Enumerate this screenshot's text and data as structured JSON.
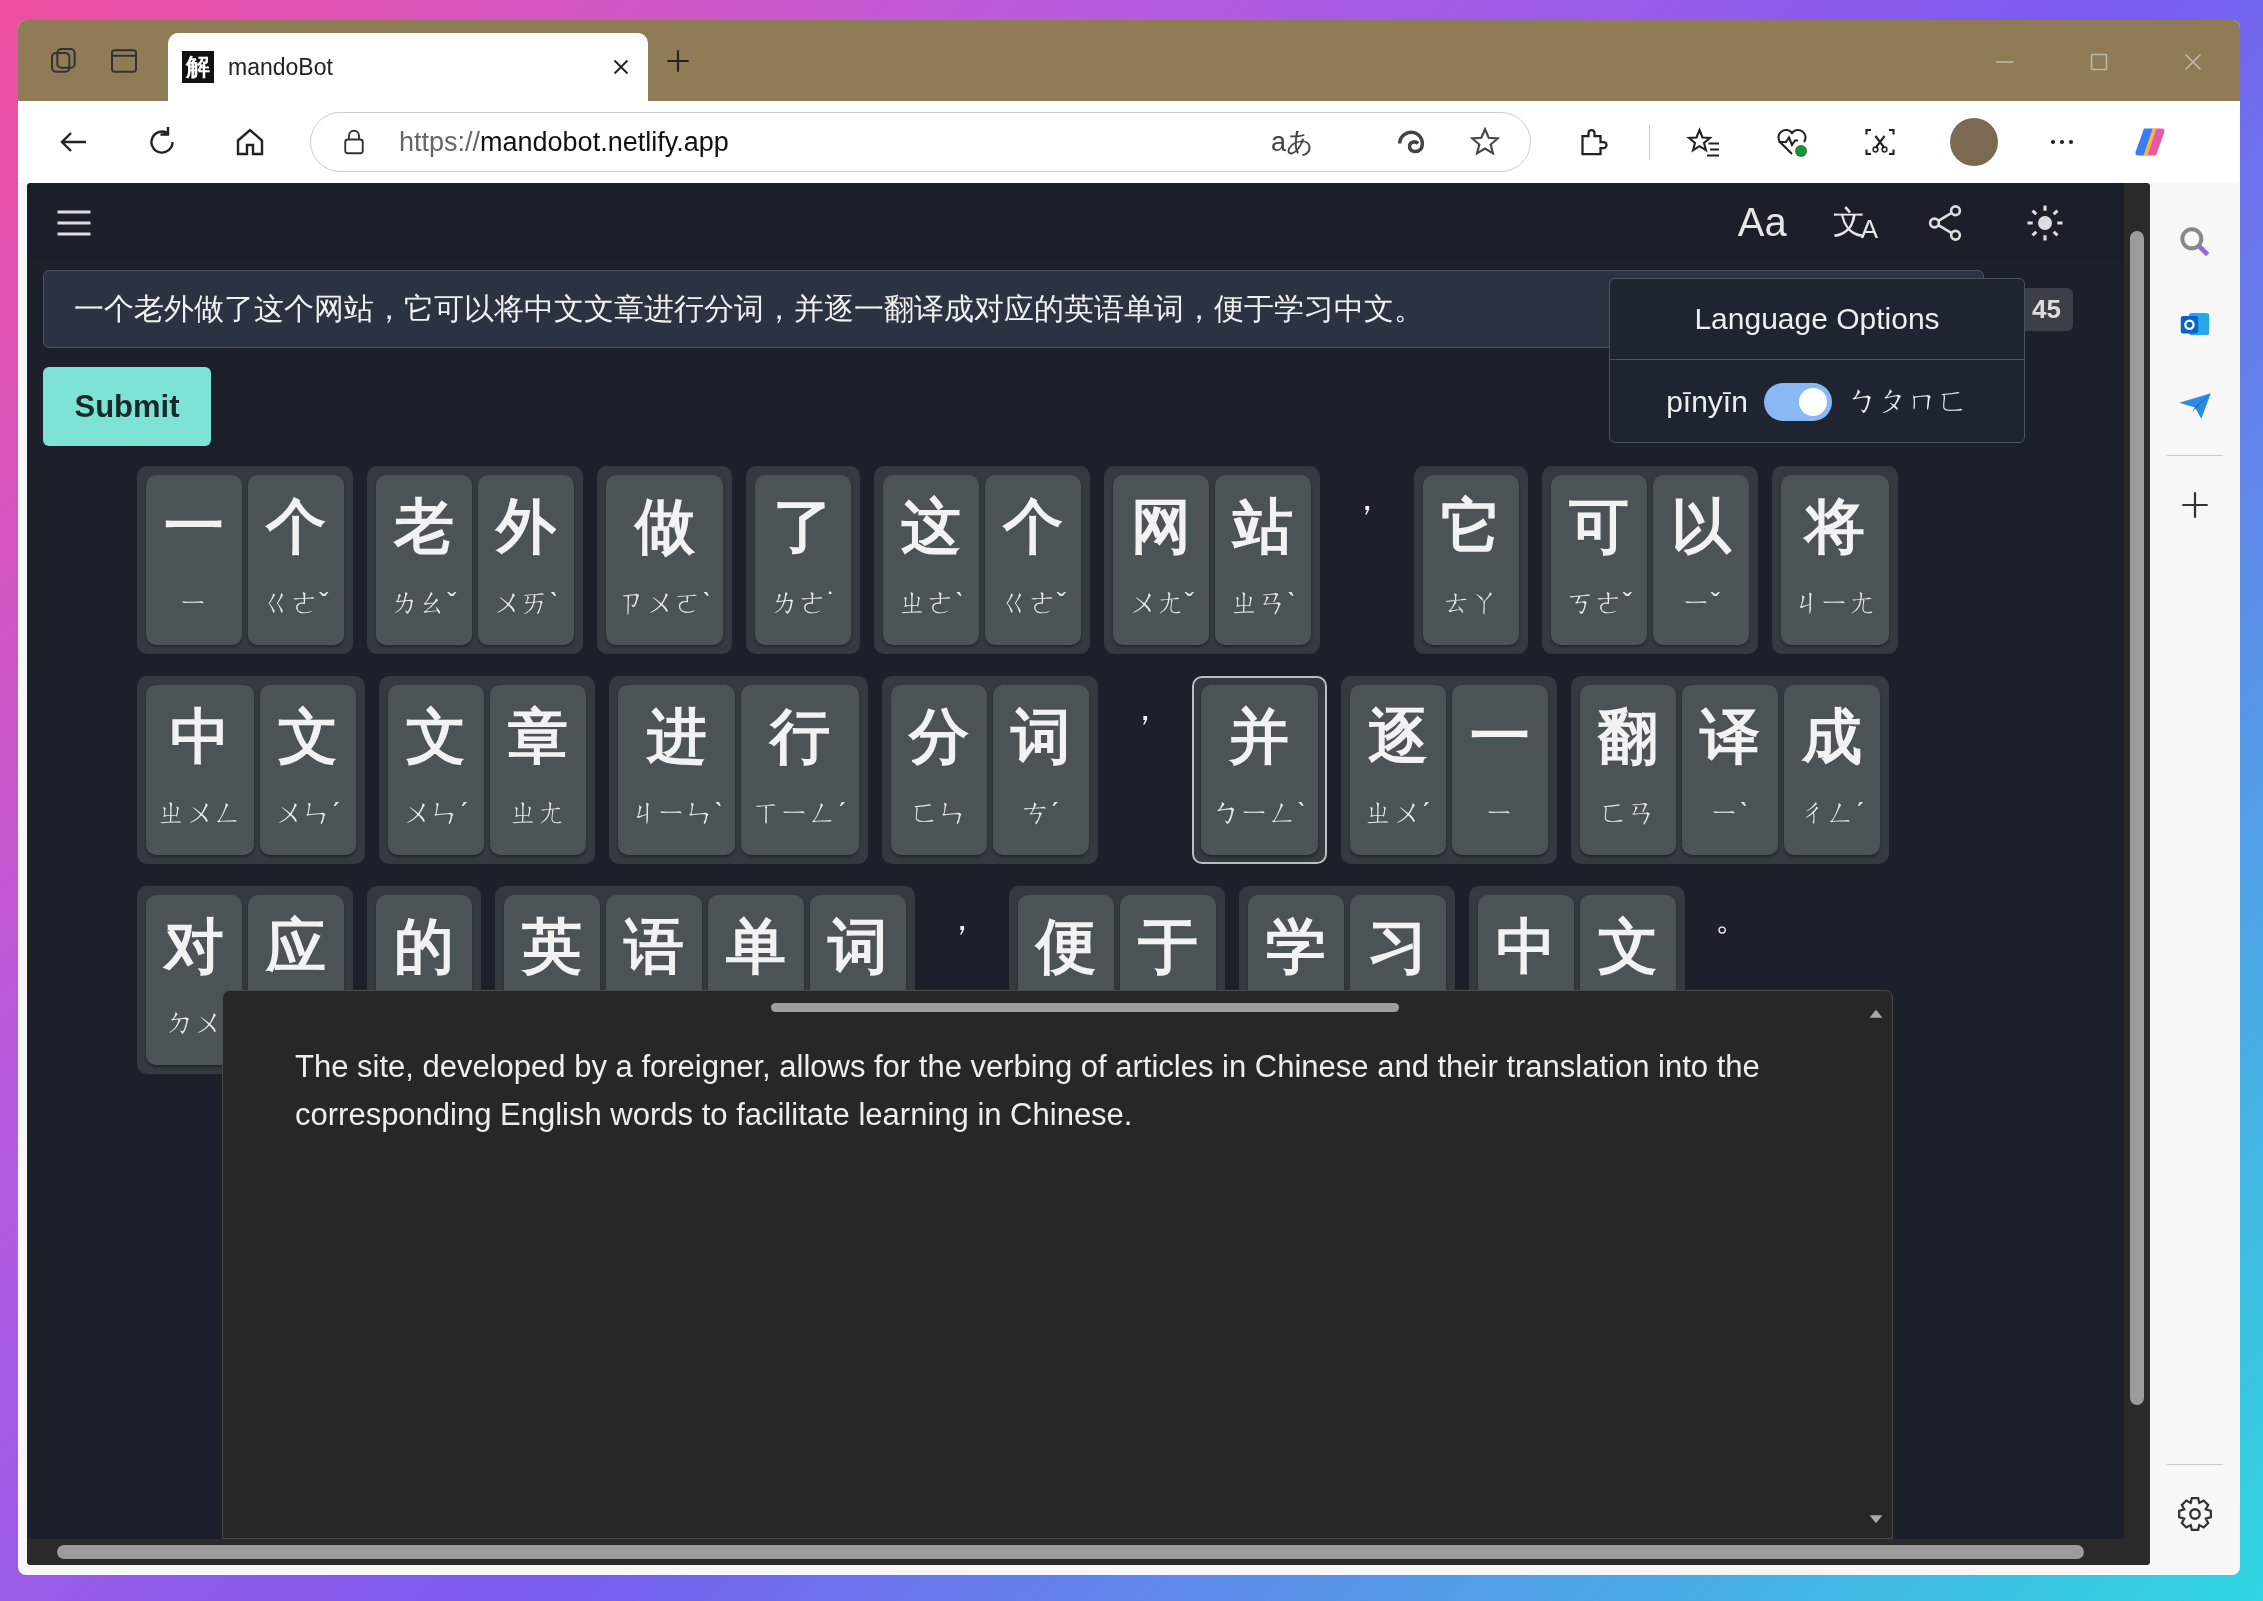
{
  "browser": {
    "tab": {
      "favicon": "解",
      "title": "mandoBot"
    },
    "address_bar": {
      "scheme": "https://",
      "host": "mandobot.netlify.app",
      "read_aloud_glyph": "aあ"
    }
  },
  "header": {
    "font_button": "Aa",
    "language_button": [
      "文",
      "A"
    ]
  },
  "input": {
    "value": "一个老外做了这个网站，它可以将中文文章进行分词，并逐一翻译成对应的英语单词，便于学习中文。",
    "count": "45"
  },
  "submit": "Submit",
  "language_popup": {
    "title": "Language Options",
    "left_label": "pīnyīn",
    "right_label": "ㄅㄆㄇㄈ",
    "on": true
  },
  "rows": [
    [
      {
        "kind": "word",
        "selected": false,
        "chars": [
          {
            "hanzi": "一",
            "zhuyin": "ㄧ"
          },
          {
            "hanzi": "个",
            "zhuyin": "ㄍㄜˇ"
          }
        ]
      },
      {
        "kind": "word",
        "selected": false,
        "chars": [
          {
            "hanzi": "老",
            "zhuyin": "ㄌㄠˇ"
          },
          {
            "hanzi": "外",
            "zhuyin": "ㄨㄞˋ"
          }
        ]
      },
      {
        "kind": "word",
        "selected": false,
        "chars": [
          {
            "hanzi": "做",
            "zhuyin": "ㄗㄨㄛˋ"
          }
        ]
      },
      {
        "kind": "word",
        "selected": false,
        "chars": [
          {
            "hanzi": "了",
            "zhuyin": "ㄌㄜ˙"
          }
        ]
      },
      {
        "kind": "word",
        "selected": false,
        "chars": [
          {
            "hanzi": "这",
            "zhuyin": "ㄓㄜˋ"
          },
          {
            "hanzi": "个",
            "zhuyin": "ㄍㄜˇ"
          }
        ]
      },
      {
        "kind": "word",
        "selected": false,
        "chars": [
          {
            "hanzi": "网",
            "zhuyin": "ㄨㄤˇ"
          },
          {
            "hanzi": "站",
            "zhuyin": "ㄓㄢˋ"
          }
        ]
      },
      {
        "kind": "punct",
        "text": "，"
      },
      {
        "kind": "word",
        "selected": false,
        "chars": [
          {
            "hanzi": "它",
            "zhuyin": "ㄊㄚ"
          }
        ]
      },
      {
        "kind": "word",
        "selected": false,
        "chars": [
          {
            "hanzi": "可",
            "zhuyin": "ㄎㄜˇ"
          },
          {
            "hanzi": "以",
            "zhuyin": "ㄧˇ"
          }
        ]
      },
      {
        "kind": "word",
        "selected": false,
        "chars": [
          {
            "hanzi": "将",
            "zhuyin": "ㄐㄧㄤ"
          }
        ]
      }
    ],
    [
      {
        "kind": "word",
        "selected": false,
        "chars": [
          {
            "hanzi": "中",
            "zhuyin": "ㄓㄨㄥ"
          },
          {
            "hanzi": "文",
            "zhuyin": "ㄨㄣˊ"
          }
        ]
      },
      {
        "kind": "word",
        "selected": false,
        "chars": [
          {
            "hanzi": "文",
            "zhuyin": "ㄨㄣˊ"
          },
          {
            "hanzi": "章",
            "zhuyin": "ㄓㄤ"
          }
        ]
      },
      {
        "kind": "word",
        "selected": false,
        "chars": [
          {
            "hanzi": "进",
            "zhuyin": "ㄐㄧㄣˋ"
          },
          {
            "hanzi": "行",
            "zhuyin": "ㄒㄧㄥˊ"
          }
        ]
      },
      {
        "kind": "word",
        "selected": false,
        "chars": [
          {
            "hanzi": "分",
            "zhuyin": "ㄈㄣ"
          },
          {
            "hanzi": "词",
            "zhuyin": "ㄘˊ"
          }
        ]
      },
      {
        "kind": "punct",
        "text": "，"
      },
      {
        "kind": "word",
        "selected": true,
        "chars": [
          {
            "hanzi": "并",
            "zhuyin": "ㄅㄧㄥˋ"
          }
        ]
      },
      {
        "kind": "word",
        "selected": false,
        "chars": [
          {
            "hanzi": "逐",
            "zhuyin": "ㄓㄨˊ"
          },
          {
            "hanzi": "一",
            "zhuyin": "ㄧ"
          }
        ]
      },
      {
        "kind": "word",
        "selected": false,
        "chars": [
          {
            "hanzi": "翻",
            "zhuyin": "ㄈㄢ"
          },
          {
            "hanzi": "译",
            "zhuyin": "ㄧˋ"
          },
          {
            "hanzi": "成",
            "zhuyin": "ㄔㄥˊ"
          }
        ]
      }
    ],
    [
      {
        "kind": "word",
        "selected": false,
        "chars": [
          {
            "hanzi": "对",
            "zhuyin": "ㄉㄨ"
          },
          {
            "hanzi": "应"
          }
        ]
      },
      {
        "kind": "word",
        "selected": false,
        "chars": [
          {
            "hanzi": "的"
          }
        ]
      },
      {
        "kind": "word",
        "selected": false,
        "chars": [
          {
            "hanzi": "英"
          },
          {
            "hanzi": "语"
          },
          {
            "hanzi": "单"
          },
          {
            "hanzi": "词"
          }
        ]
      },
      {
        "kind": "punct",
        "text": "，"
      },
      {
        "kind": "word",
        "selected": false,
        "chars": [
          {
            "hanzi": "便"
          },
          {
            "hanzi": "于"
          }
        ]
      },
      {
        "kind": "word",
        "selected": false,
        "chars": [
          {
            "hanzi": "学"
          },
          {
            "hanzi": "习"
          }
        ]
      },
      {
        "kind": "word",
        "selected": false,
        "chars": [
          {
            "hanzi": "中"
          },
          {
            "hanzi": "文"
          }
        ]
      },
      {
        "kind": "punct",
        "text": "。"
      }
    ]
  ],
  "translation": "The site, developed by a foreigner, allows for the verbing of articles in Chinese and their translation into the corresponding English words to facilitate learning in Chinese."
}
